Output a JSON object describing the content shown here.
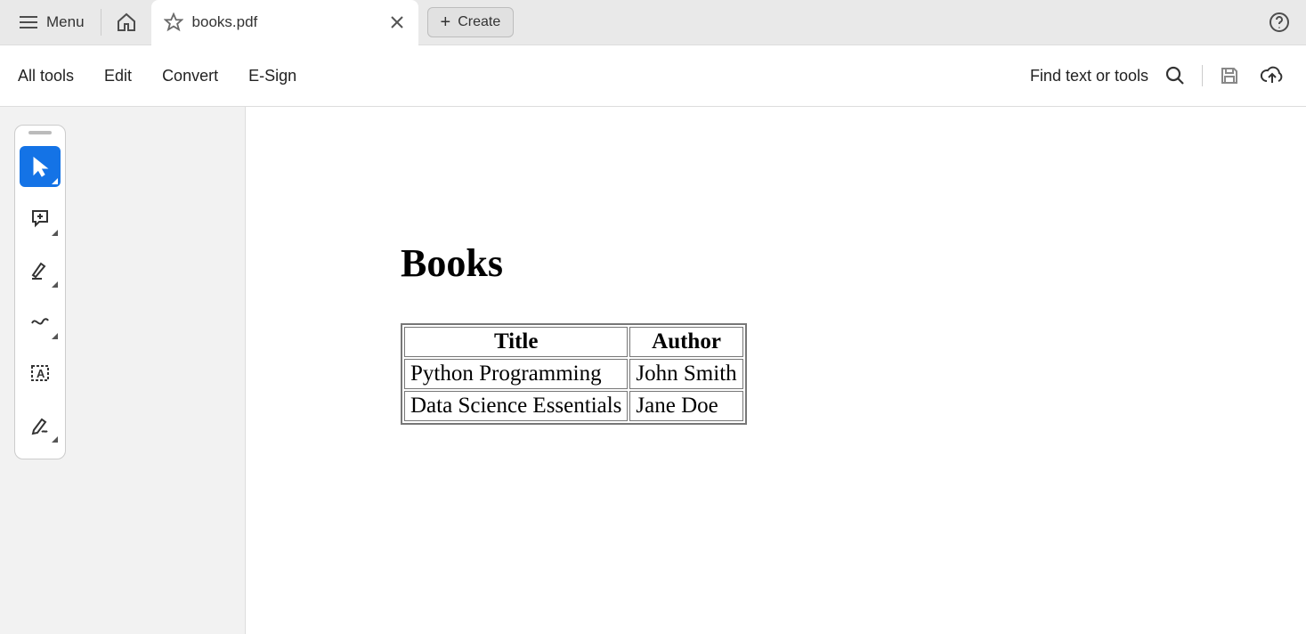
{
  "top": {
    "menu_label": "Menu",
    "tab_title": "books.pdf",
    "create_label": "Create"
  },
  "toolbar": {
    "items": [
      "All tools",
      "Edit",
      "Convert",
      "E-Sign"
    ],
    "find_label": "Find text or tools"
  },
  "document": {
    "heading": "Books",
    "columns": [
      "Title",
      "Author"
    ],
    "rows": [
      {
        "title": "Python Programming",
        "author": "John Smith"
      },
      {
        "title": "Data Science Essentials",
        "author": "Jane Doe"
      }
    ]
  }
}
